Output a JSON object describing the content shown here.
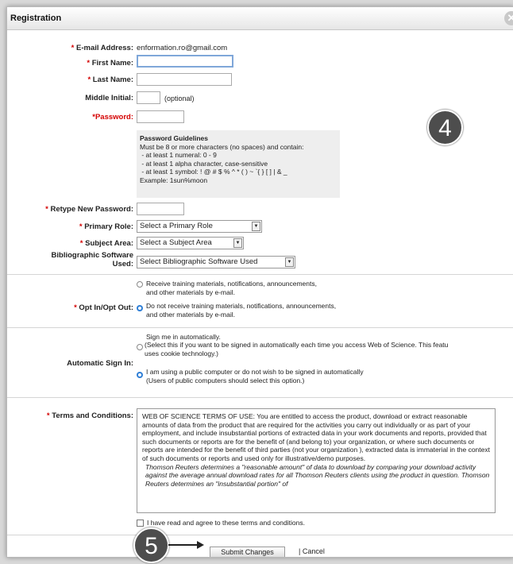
{
  "dialog": {
    "title": "Registration",
    "close_glyph": "✕"
  },
  "fields": {
    "email_label": "E-mail Address:",
    "email_value": "enformation.ro@gmail.com",
    "first_name_label": "First Name:",
    "first_name_value": "",
    "last_name_label": "Last Name:",
    "last_name_value": "",
    "middle_initial_label": "Middle Initial:",
    "middle_initial_value": "",
    "middle_initial_hint": "(optional)",
    "password_label": "*Password:",
    "retype_label": "Retype New Password:",
    "primary_role_label": "Primary Role:",
    "primary_role_value": "Select a Primary Role",
    "subject_area_label": "Subject Area:",
    "subject_area_value": "Select a Subject Area",
    "biblio_label_1": "Bibliographic Software",
    "biblio_label_2": "Used:",
    "biblio_value": "Select Bibliographic Software Used"
  },
  "required_mark": "* ",
  "password_guidelines": {
    "title": "Password Guidelines",
    "lines": [
      "Must be 8 or more characters (no spaces) and contain:",
      " - at least 1 numeral: 0 - 9",
      " - at least 1 alpha character, case-sensitive",
      " - at least 1 symbol: ! @ # $ % ^ * ( ) ~ `{ } [ ] | & _",
      "Example: 1sun%moon"
    ]
  },
  "opt_in": {
    "label": "Opt In/Opt Out:",
    "option_1_line_1": "Receive training materials, notifications, announcements,",
    "option_1_line_2": "and other materials by e-mail.",
    "option_2_line_1": "Do not receive training materials, notifications, announcements,",
    "option_2_line_2": "and other materials by e-mail.",
    "selected": 2
  },
  "auto_sign_in": {
    "label": "Automatic Sign In:",
    "option_1_line_1": "Sign me in automatically.",
    "option_1_line_2": "(Select this if you want to be signed in automatically each time you access Web of Science. This featu",
    "option_1_line_3": "uses cookie technology.)",
    "option_2_line_1": "I am using a public computer or do not wish to be signed in automatically",
    "option_2_line_2": "(Users of public computers should select this option.)",
    "selected": 2
  },
  "terms": {
    "label": "Terms and Conditions:",
    "text": "WEB OF SCIENCE TERMS OF USE: You are entitled to access the product, download or extract reasonable amounts of data from the product that are required for the activities you carry out individually or as part of your employment, and include insubstantial portions of extracted data in your work documents and reports, provided that such documents or reports are for the benefit of (and belong to) your organization, or where such documents or reports are intended for the benefit of third parties (not your organization ), extracted data is immaterial in the context of such documents or reports and used only for illustrative/demo purposes.",
    "italic_text": "Thomson Reuters determines a \"reasonable amount\" of data to download by comparing your download activity against the average annual download rates for all Thomson Reuters clients using the product in question. Thomson Reuters determines an \"insubstantial portion\" of",
    "agree_label": "I have read and agree to these terms and conditions."
  },
  "actions": {
    "submit_label": "Submit Changes",
    "cancel_label": "| Cancel"
  },
  "callouts": {
    "badge_4": "4",
    "badge_5": "5"
  },
  "colors": {
    "required": "#d40000",
    "radio_selected": "#2f7fd6",
    "badge": "#4d4d4d"
  }
}
